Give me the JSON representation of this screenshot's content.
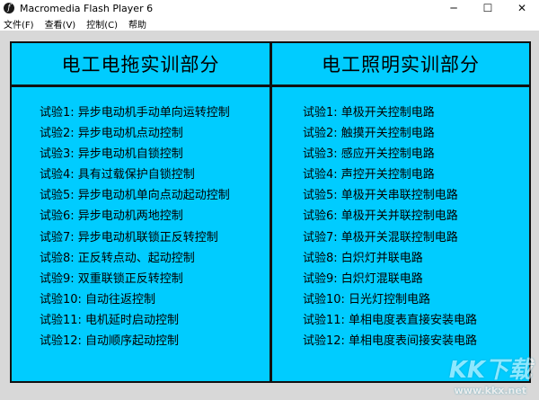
{
  "window": {
    "title": "Macromedia Flash Player 6",
    "icon": "flash-icon",
    "controls": {
      "minimize": "─",
      "maximize": "☐",
      "close": "✕"
    }
  },
  "menu": {
    "items": [
      {
        "label": "文件(F)"
      },
      {
        "label": "查看(V)"
      },
      {
        "label": "控制(C)"
      },
      {
        "label": "帮助"
      }
    ]
  },
  "colors": {
    "panel": "#00ccff",
    "border": "#111111",
    "background": "#d8d8d8"
  },
  "left": {
    "heading": "电工电拖实训部分",
    "items": [
      {
        "label": "试验1:  异步电动机手动单向运转控制"
      },
      {
        "label": "试验2:  异步电动机点动控制"
      },
      {
        "label": "试验3: 异步电动机自锁控制"
      },
      {
        "label": "试验4:  具有过载保护自锁控制"
      },
      {
        "label": "试验5:  异步电动机单向点动起动控制"
      },
      {
        "label": "试验6:  异步电动机两地控制"
      },
      {
        "label": "试验7:  异步电动机联锁正反转控制"
      },
      {
        "label": "试验8:  正反转点动、起动控制"
      },
      {
        "label": "试验9:  双重联锁正反转控制"
      },
      {
        "label": "试验10:  自动往返控制"
      },
      {
        "label": "试验11:  电机延时启动控制"
      },
      {
        "label": "试验12:  自动顺序起动控制"
      }
    ]
  },
  "right": {
    "heading": "电工照明实训部分",
    "items": [
      {
        "label": "试验1:  单极开关控制电路"
      },
      {
        "label": "试验2:  触摸开关控制电路"
      },
      {
        "label": "试验3:  感应开关控制电路"
      },
      {
        "label": "试验4:  声控开关控制电路"
      },
      {
        "label": "试验5:  单极开关串联控制电路"
      },
      {
        "label": "试验6:  单极开关并联控制电路"
      },
      {
        "label": "试验7:  单极开关混联控制电路"
      },
      {
        "label": "试验8:  白炽灯并联电路"
      },
      {
        "label": "试验9:  白炽灯混联电路"
      },
      {
        "label": "试验10:  日光灯控制电路"
      },
      {
        "label": "试验11:  单相电度表直接安装电路"
      },
      {
        "label": "试验12:  单相电度表间接安装电路"
      }
    ]
  },
  "watermark": {
    "logo": "KK下载",
    "url": "www.kkx.net"
  }
}
